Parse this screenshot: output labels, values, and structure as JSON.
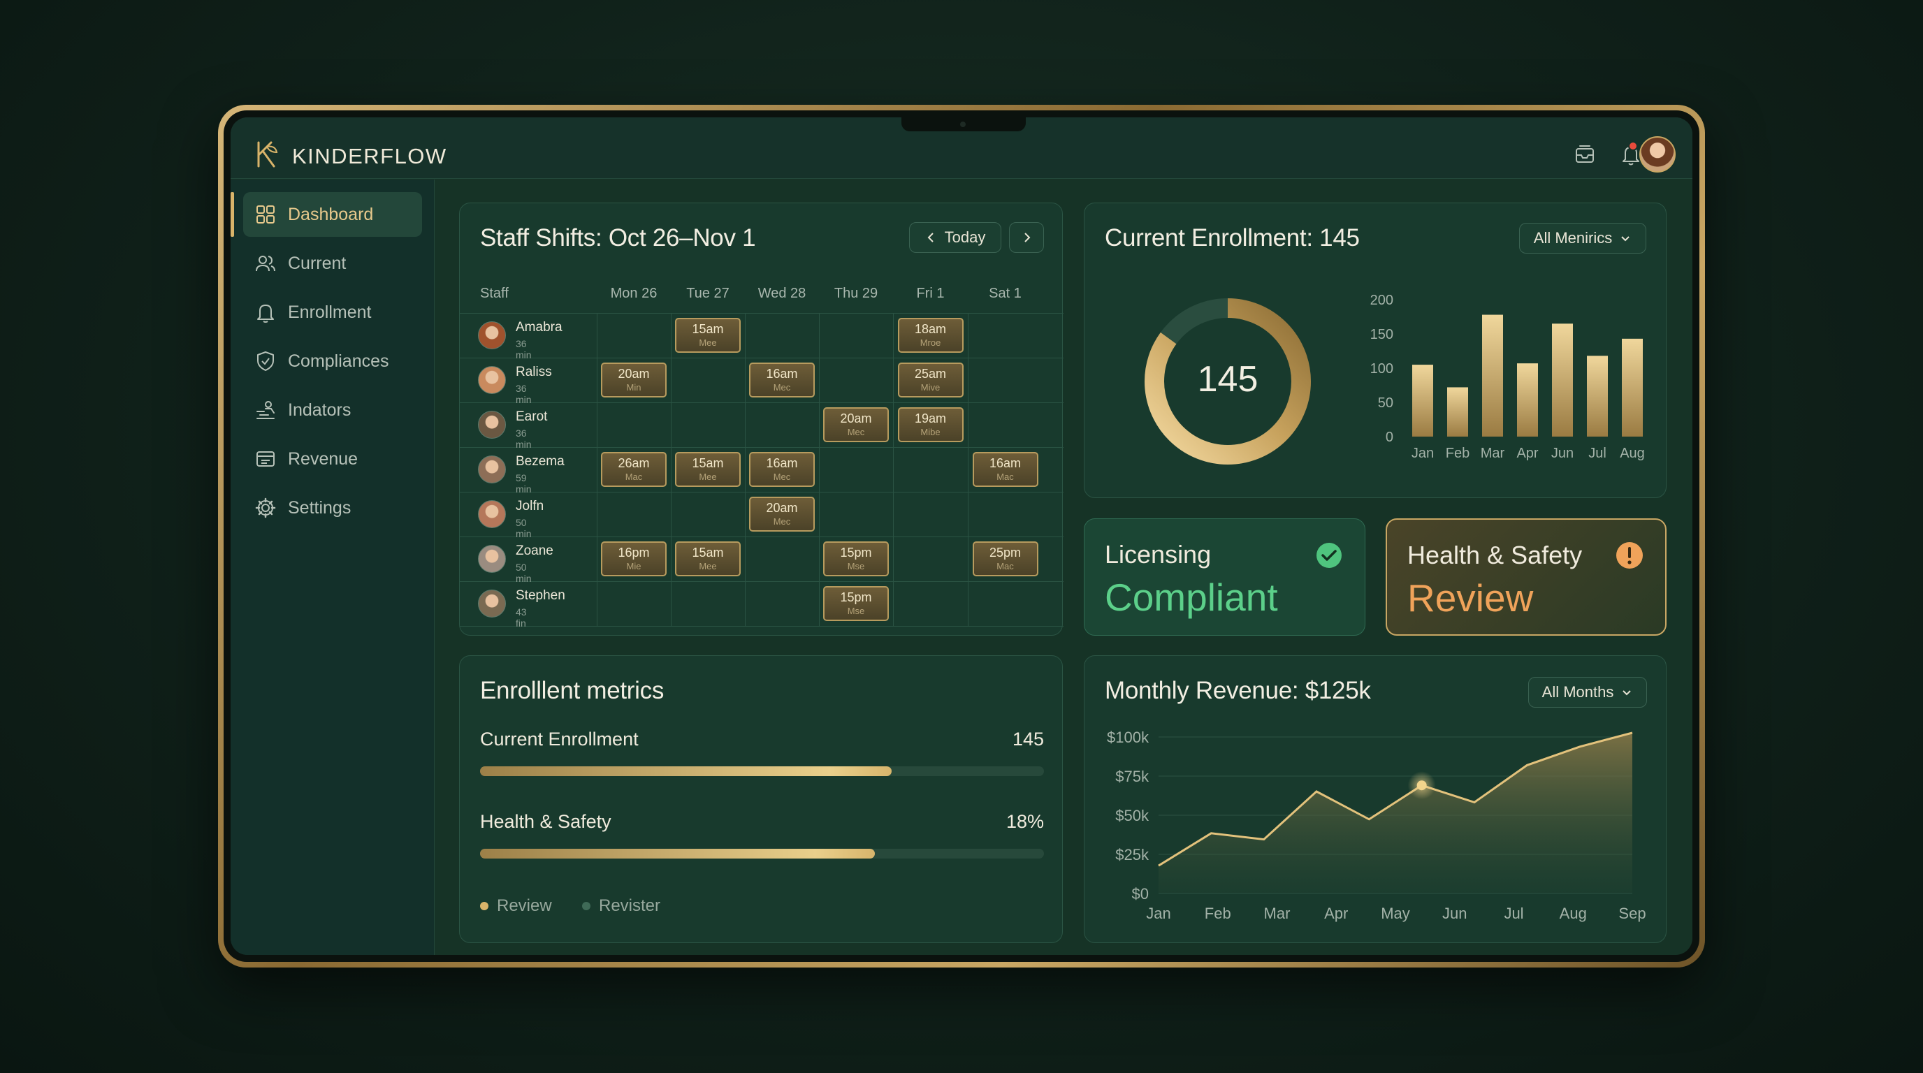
{
  "app": {
    "brand": "KINDERFLOW"
  },
  "sidebar": {
    "items": [
      {
        "label": "Dashboard",
        "icon": "grid-icon",
        "active": true
      },
      {
        "label": "Current",
        "icon": "users-icon"
      },
      {
        "label": "Enrollment",
        "icon": "bell-icon"
      },
      {
        "label": "Compliances",
        "icon": "shield-icon"
      },
      {
        "label": "Indators",
        "icon": "indicators-icon"
      },
      {
        "label": "Revenue",
        "icon": "revenue-icon"
      },
      {
        "label": "Settings",
        "icon": "gear-icon"
      }
    ]
  },
  "shifts": {
    "title": "Staff Shifts: Oct 26–Nov 1",
    "today_label": "Today",
    "staff_header": "Staff",
    "days": [
      "Mon 26",
      "Tue 27",
      "Wed 28",
      "Thu 29",
      "Fri 1",
      "Sat 1"
    ],
    "staff": [
      {
        "name": "Amabra",
        "sub": "36 min",
        "shifts": [
          null,
          {
            "time": "15am",
            "sub": "Mee"
          },
          null,
          null,
          {
            "time": "18am",
            "sub": "Mroe"
          },
          null
        ]
      },
      {
        "name": "Raliss",
        "sub": "36 min",
        "shifts": [
          {
            "time": "20am",
            "sub": "Min"
          },
          null,
          {
            "time": "16am",
            "sub": "Mec"
          },
          null,
          {
            "time": "25am",
            "sub": "Mive"
          },
          null
        ]
      },
      {
        "name": "Earot",
        "sub": "36 min",
        "shifts": [
          null,
          null,
          null,
          {
            "time": "20am",
            "sub": "Mec"
          },
          {
            "time": "19am",
            "sub": "Mibe"
          },
          null
        ]
      },
      {
        "name": "Bezema",
        "sub": "59 min",
        "shifts": [
          {
            "time": "26am",
            "sub": "Mac"
          },
          {
            "time": "15am",
            "sub": "Mee"
          },
          {
            "time": "16am",
            "sub": "Mec"
          },
          null,
          null,
          {
            "time": "16am",
            "sub": "Mac"
          }
        ]
      },
      {
        "name": "Jolfn",
        "sub": "50 min",
        "shifts": [
          null,
          null,
          {
            "time": "20am",
            "sub": "Mec"
          },
          null,
          null,
          null
        ]
      },
      {
        "name": "Zoane",
        "sub": "50 min",
        "shifts": [
          {
            "time": "16pm",
            "sub": "Mie"
          },
          {
            "time": "15am",
            "sub": "Mee"
          },
          null,
          {
            "time": "15pm",
            "sub": "Mse"
          },
          null,
          {
            "time": "25pm",
            "sub": "Mac"
          }
        ]
      },
      {
        "name": "Stephen",
        "sub": "43 fin",
        "shifts": [
          null,
          null,
          null,
          {
            "time": "15pm",
            "sub": "Mse"
          },
          null,
          null
        ]
      }
    ]
  },
  "enrollment_card": {
    "title": "Current Enrollment: 145",
    "filter": "All Menirics",
    "donut_value": "145",
    "donut_fraction": 0.85
  },
  "licensing": {
    "label": "Licensing",
    "value": "Compliant",
    "color": "#5cd08a"
  },
  "health": {
    "label": "Health & Safety",
    "value": "Review",
    "color": "#f0a35a"
  },
  "metrics": {
    "title": "Enrolllent metrics",
    "rows": [
      {
        "label": "Current Enrollment",
        "value": "145",
        "fraction": 0.73
      },
      {
        "label": "Health & Safety",
        "value": "18%",
        "fraction": 0.7
      }
    ],
    "legend": [
      {
        "label": "Review",
        "color": "#d9b46a"
      },
      {
        "label": "Revister",
        "color": "#3f6a57"
      }
    ]
  },
  "revenue_card": {
    "title": "Monthly Revenue: $125k",
    "filter": "All Months"
  },
  "chart_data": [
    {
      "type": "bar",
      "categories": [
        "Jan",
        "Feb",
        "Mar",
        "Apr",
        "Jun",
        "Jul",
        "Aug"
      ],
      "values": [
        105,
        72,
        178,
        107,
        165,
        118,
        143
      ],
      "ylim": [
        0,
        200
      ],
      "yticks": [
        0,
        50,
        100,
        150,
        200
      ]
    },
    {
      "type": "area",
      "categories": [
        "Jan",
        "Feb",
        "Mar",
        "Apr",
        "May",
        "Jun",
        "Jul",
        "Aug",
        "Sep"
      ],
      "values": [
        18,
        39,
        35,
        66,
        48,
        70,
        59,
        83,
        95,
        104
      ],
      "ylim": [
        0,
        100
      ],
      "yticks": [
        "$0",
        "$25k",
        "$50k",
        "$75k",
        "$100k"
      ],
      "highlight_index": 5
    }
  ]
}
